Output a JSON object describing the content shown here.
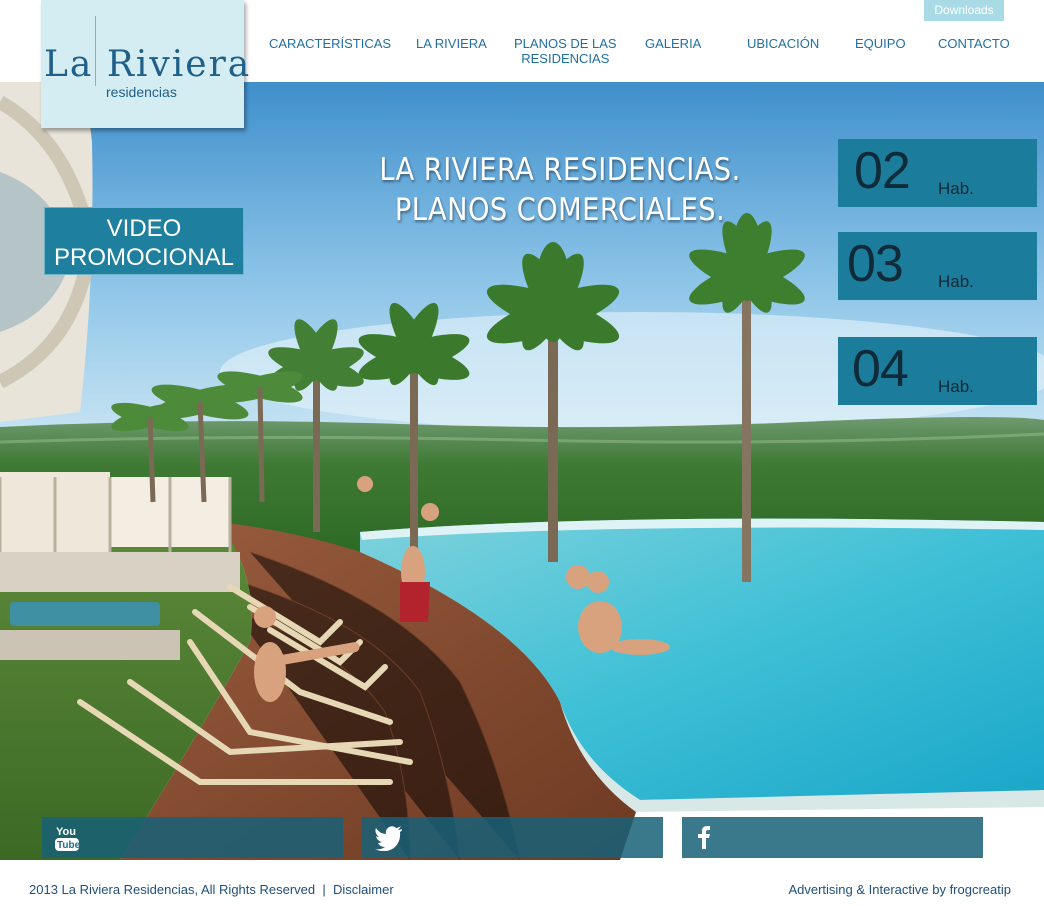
{
  "header": {
    "downloads_label": "Downloads",
    "nav": [
      {
        "id": "caracteristicas",
        "label": "CARACTERÍSTICAS"
      },
      {
        "id": "la-riviera",
        "label": "LA RIVIERA"
      },
      {
        "id": "planos",
        "label": "PLANOS DE LAS\nRESIDENCIAS"
      },
      {
        "id": "galeria",
        "label": "GALERIA"
      },
      {
        "id": "ubicacion",
        "label": "UBICACIÓN"
      },
      {
        "id": "equipo",
        "label": "EQUIPO"
      },
      {
        "id": "contacto",
        "label": "CONTACTO"
      }
    ]
  },
  "logo": {
    "name": "La Riviera",
    "subtitle": "residencias"
  },
  "hero": {
    "title_line1": "LA RIVIERA RESIDENCIAS.",
    "title_line2": "PLANOS COMERCIALES.",
    "video_button": "VIDEO\nPROMOCIONAL",
    "habitaciones": [
      {
        "number": "02",
        "unit": "Hab."
      },
      {
        "number": "03",
        "unit": "Hab."
      },
      {
        "number": "04",
        "unit": "Hab."
      }
    ]
  },
  "social": [
    {
      "name": "youtube",
      "icon": "youtube-icon"
    },
    {
      "name": "twitter",
      "icon": "twitter-icon"
    },
    {
      "name": "facebook",
      "icon": "facebook-icon"
    }
  ],
  "footer": {
    "copyright": "2013 La Riviera Residencias, All Rights Reserved",
    "separator": "|",
    "disclaimer": "Disclaimer",
    "credit": "Advertising & Interactive by frogcreatip"
  },
  "colors": {
    "accent": "#1b7d9b",
    "nav_text": "#1f6fa1",
    "logo_bg": "#d3edf2",
    "downloads_bg": "#a9dbe7"
  }
}
